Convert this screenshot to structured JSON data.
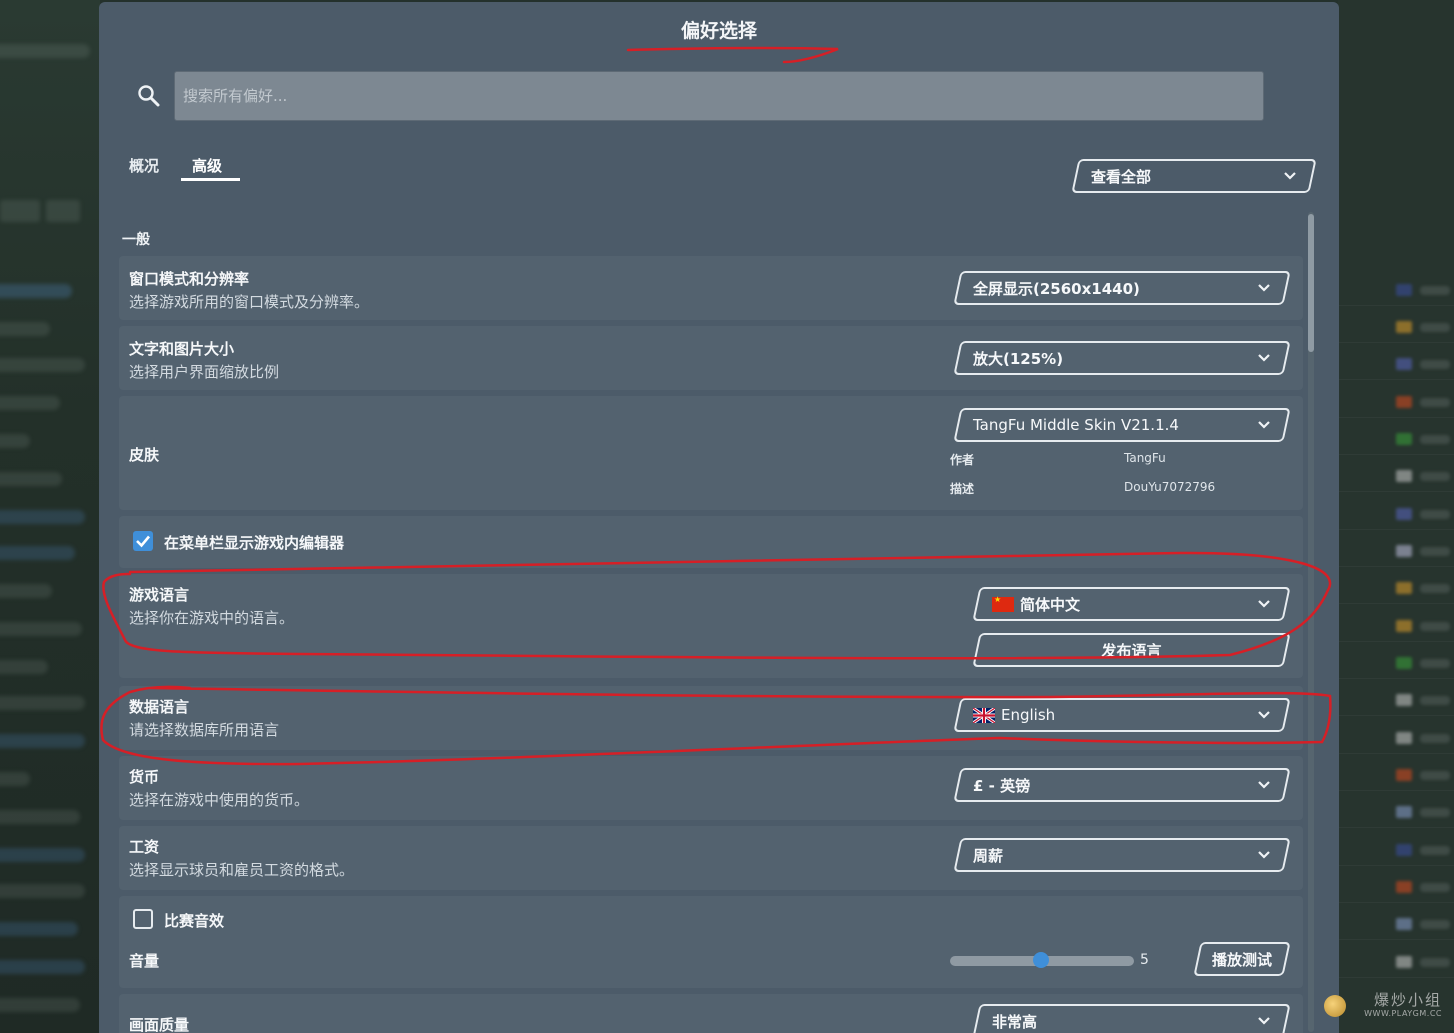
{
  "dialog": {
    "title": "偏好选择",
    "search": {
      "placeholder": "搜索所有偏好..."
    },
    "tabs": [
      {
        "label": "概况",
        "active": false
      },
      {
        "label": "高级",
        "active": true
      }
    ],
    "filter": {
      "value": "查看全部"
    },
    "section_general": "一般",
    "settings": {
      "window_mode": {
        "title": "窗口模式和分辨率",
        "desc": "选择游戏所用的窗口模式及分辨率。",
        "value": "全屏显示(2560x1440)"
      },
      "ui_scale": {
        "title": "文字和图片大小",
        "desc": "选择用户界面缩放比例",
        "value": "放大(125%)"
      },
      "skin": {
        "title": "皮肤",
        "value": "TangFu Middle Skin  V21.1.4",
        "author_label": "作者",
        "author": "TangFu",
        "desc_label": "描述",
        "desc": "DouYu7072796"
      },
      "editor_menu": {
        "label": "在菜单栏显示游戏内编辑器",
        "checked": true
      },
      "game_language": {
        "title": "游戏语言",
        "desc": "选择你在游戏中的语言。",
        "value": "简体中文",
        "publish_label": "发布语言"
      },
      "data_language": {
        "title": "数据语言",
        "desc": "请选择数据库所用语言",
        "value": "English"
      },
      "currency": {
        "title": "货币",
        "desc": "选择在游戏中使用的货币。",
        "value": "£ - 英镑"
      },
      "wage": {
        "title": "工资",
        "desc": "选择显示球员和雇员工资的格式。",
        "value": "周薪"
      },
      "match_sound": {
        "label": "比赛音效",
        "checked": false
      },
      "volume": {
        "title": "音量",
        "value": "5",
        "level_fraction": 0.5,
        "test_label": "播放测试"
      },
      "graphics": {
        "title": "画面质量",
        "value": "非常高"
      }
    }
  },
  "watermark": {
    "text": "爆炒小组",
    "url": "WWW.PLAYGM.CC"
  },
  "colors": {
    "accent": "#3f8fd9",
    "panel": "#4c5b69",
    "card": "#53626f",
    "annotation": "#d61f26"
  }
}
